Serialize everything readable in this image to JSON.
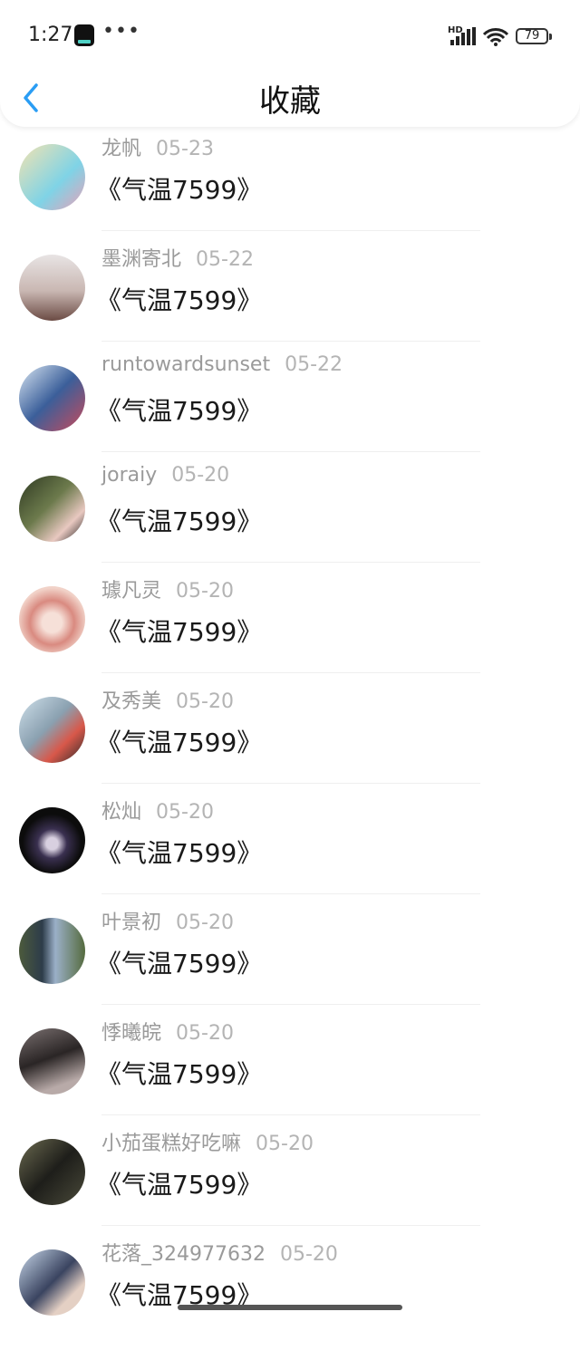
{
  "status_bar": {
    "time": "1:27",
    "more": "•••",
    "hd": "HD",
    "battery": "79"
  },
  "header": {
    "title": "收藏"
  },
  "icons": {
    "back": "chevron-left-icon",
    "accent": "#2a9df4"
  },
  "items": [
    {
      "user": "龙帆",
      "date": "05-23",
      "book": "《气温7599》",
      "avatar_color": "#e9d9a8"
    },
    {
      "user": "墨渊寄北",
      "date": "05-22",
      "book": "《气温7599》",
      "avatar_color": "#d8cfcf"
    },
    {
      "user": "runtowardsunset",
      "date": "05-22",
      "book": "《气温7599》",
      "avatar_color": "#5d7fa8"
    },
    {
      "user": "joraiy",
      "date": "05-20",
      "book": "《气温7599》",
      "avatar_color": "#3f4a2f"
    },
    {
      "user": "璩凡灵",
      "date": "05-20",
      "book": "《气温7599》",
      "avatar_color": "#e8b8a8"
    },
    {
      "user": "及秀美",
      "date": "05-20",
      "book": "《气温7599》",
      "avatar_color": "#9fb3c4"
    },
    {
      "user": "松灿",
      "date": "05-20",
      "book": "《气温7599》",
      "avatar_color": "#1b1b1b"
    },
    {
      "user": "叶景初",
      "date": "05-20",
      "book": "《气温7599》",
      "avatar_color": "#5c6b4e"
    },
    {
      "user": "悸曦皖",
      "date": "05-20",
      "book": "《气温7599》",
      "avatar_color": "#4a4545"
    },
    {
      "user": "小茄蛋糕好吃嘛",
      "date": "05-20",
      "book": "《气温7599》",
      "avatar_color": "#3a3d2f"
    },
    {
      "user": "花落_324977632",
      "date": "05-20",
      "book": "《气温7599》",
      "avatar_color": "#8fa6c2"
    }
  ]
}
